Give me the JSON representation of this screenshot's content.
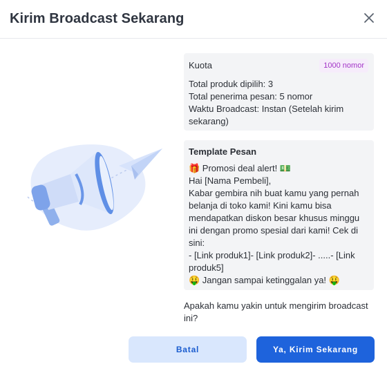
{
  "modal": {
    "title": "Kirim Broadcast Sekarang",
    "close_icon": "close-icon"
  },
  "quota": {
    "label": "Kuota",
    "badge": "1000 nomor",
    "lines": [
      "Total produk dipilih: 3",
      "Total penerima pesan: 5 nomor",
      "Waktu Broadcast: Instan (Setelah kirim sekarang)"
    ]
  },
  "template": {
    "title": "Template Pesan",
    "lines": [
      "🎁 Promosi deal alert! 💵",
      "Hai [Nama Pembeli],",
      "Kabar gembira nih buat kamu yang pernah belanja di toko kami! Kini kamu bisa mendapatkan diskon besar khusus minggu ini dengan promo spesial dari kami! Cek di sini:",
      "- [Link produk1]- [Link produk2]- .....- [Link produk5]",
      "🤑 Jangan sampai ketinggalan ya! 🤑"
    ]
  },
  "confirm_text": "Apakah kamu yakin untuk mengirim broadcast ini?",
  "buttons": {
    "cancel": "Batal",
    "send": "Ya, Kirim Sekarang"
  },
  "colors": {
    "primary": "#1e63dc",
    "secondary_bg": "#d9e7fd",
    "badge_bg": "#f6ecfb",
    "badge_text": "#a233c7"
  },
  "illustration": "megaphone-paper-plane-illustration"
}
